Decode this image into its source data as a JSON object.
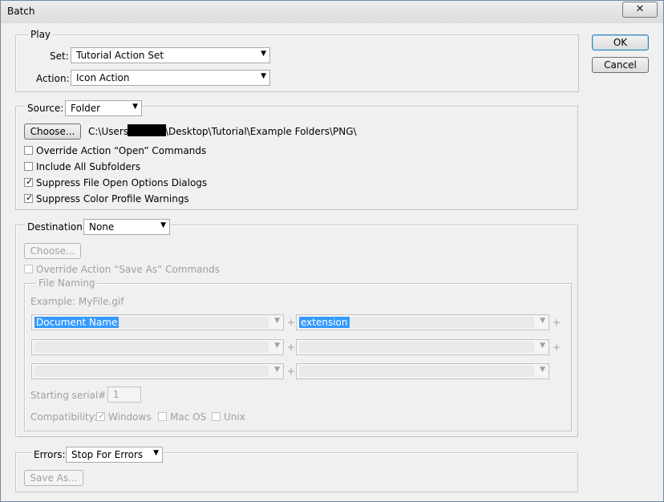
{
  "window": {
    "title": "Batch",
    "close_glyph": "✕"
  },
  "buttons": {
    "ok": "OK",
    "cancel": "Cancel"
  },
  "play": {
    "legend": "Play",
    "set_label": "Set:",
    "set_value": "Tutorial Action Set",
    "action_label": "Action:",
    "action_value": "Icon Action"
  },
  "source": {
    "label": "Source:",
    "value": "Folder",
    "choose": "Choose...",
    "path_prefix": "C:\\Users\\",
    "path_suffix": "\\Desktop\\Tutorial\\Example Folders\\PNG\\",
    "checks": [
      {
        "label": "Override Action “Open” Commands",
        "checked": false
      },
      {
        "label": "Include All Subfolders",
        "checked": false
      },
      {
        "label": "Suppress File Open Options Dialogs",
        "checked": true
      },
      {
        "label": "Suppress Color Profile Warnings",
        "checked": true
      }
    ]
  },
  "destination": {
    "label": "Destination:",
    "value": "None",
    "choose": "Choose...",
    "override_label": "Override Action “Save As” Commands",
    "file_naming": {
      "legend": "File Naming",
      "example": "Example: MyFile.gif",
      "field1": "Document Name",
      "field2": "extension",
      "plus": "+",
      "serial_label": "Starting serial#:",
      "serial_value": "1",
      "compat_label": "Compatibility:",
      "compat": [
        {
          "label": "Windows",
          "checked": true
        },
        {
          "label": "Mac OS",
          "checked": false
        },
        {
          "label": "Unix",
          "checked": false
        }
      ]
    }
  },
  "errors": {
    "label": "Errors:",
    "value": "Stop For Errors",
    "save_as": "Save As..."
  },
  "icons": {
    "dropdown": "▼",
    "check": "✓"
  }
}
